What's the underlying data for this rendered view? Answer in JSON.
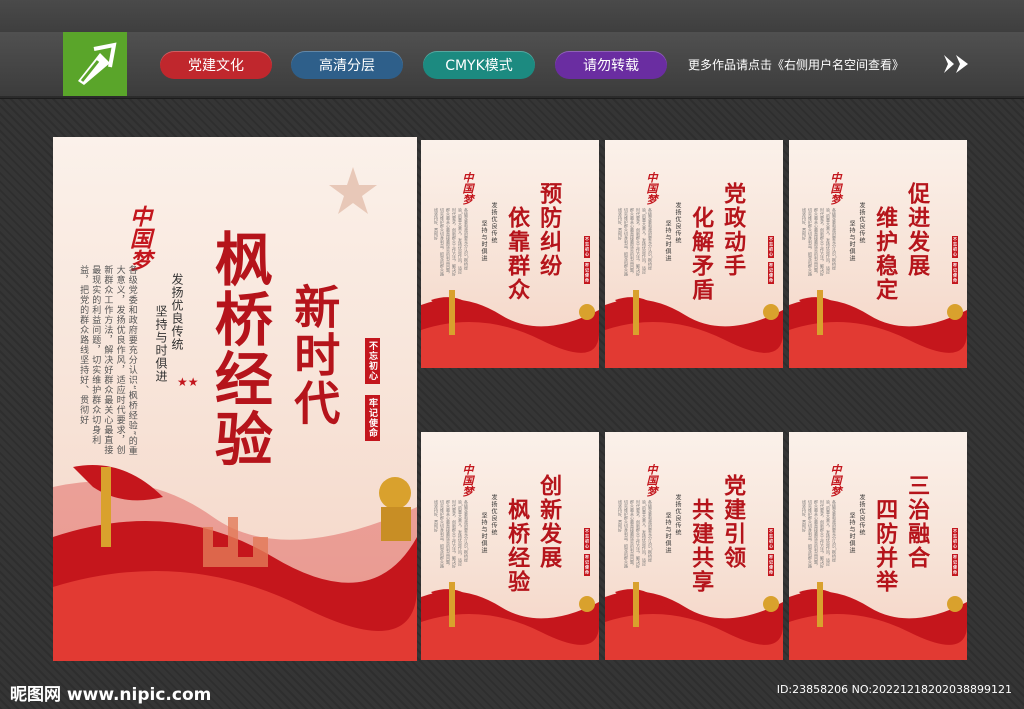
{
  "tags": [
    "党建文化",
    "高清分层",
    "CMYK模式",
    "请勿转载"
  ],
  "tag_colors": [
    "#c0272d",
    "#2e5f8a",
    "#1c8a80",
    "#6a2da1"
  ],
  "more_text": "更多作品请点击《右侧用户名空间查看》",
  "brand": "中国梦",
  "big_poster": {
    "title1": "枫桥经验",
    "title2": "新时代",
    "slogan1": "发扬优良传统",
    "slogan2": "坚持与时俱进",
    "seal1": "不忘初心",
    "seal2": "牢记使命",
    "paragraph": "各级党委和政府要充分认识“枫桥经验”的重大意义，发扬优良作风，适应时代要求，创新群众工作方法，解决好群众最关心最直接最现实的利益问题，切实维护群众切身利益，把党的群众路线坚持好、贯彻好"
  },
  "small_posters": [
    {
      "line1": "预防纠纷",
      "line2": "依靠群众"
    },
    {
      "line1": "党政动手",
      "line2": "化解矛盾"
    },
    {
      "line1": "促进发展",
      "line2": "维护稳定"
    },
    {
      "line1": "创新发展",
      "line2": "枫桥经验"
    },
    {
      "line1": "党建引领",
      "line2": "共建共享"
    },
    {
      "line1": "三治融合",
      "line2": "四防并举"
    }
  ],
  "small_slogan1": "发扬优良传统",
  "small_slogan2": "坚持与时俱进",
  "small_seal1": "不忘初心",
  "small_seal2": "牢记使命",
  "watermark_left": "昵图网 www.nipic.com",
  "watermark_right": "ID:23858206 NO:20221218202038899121"
}
